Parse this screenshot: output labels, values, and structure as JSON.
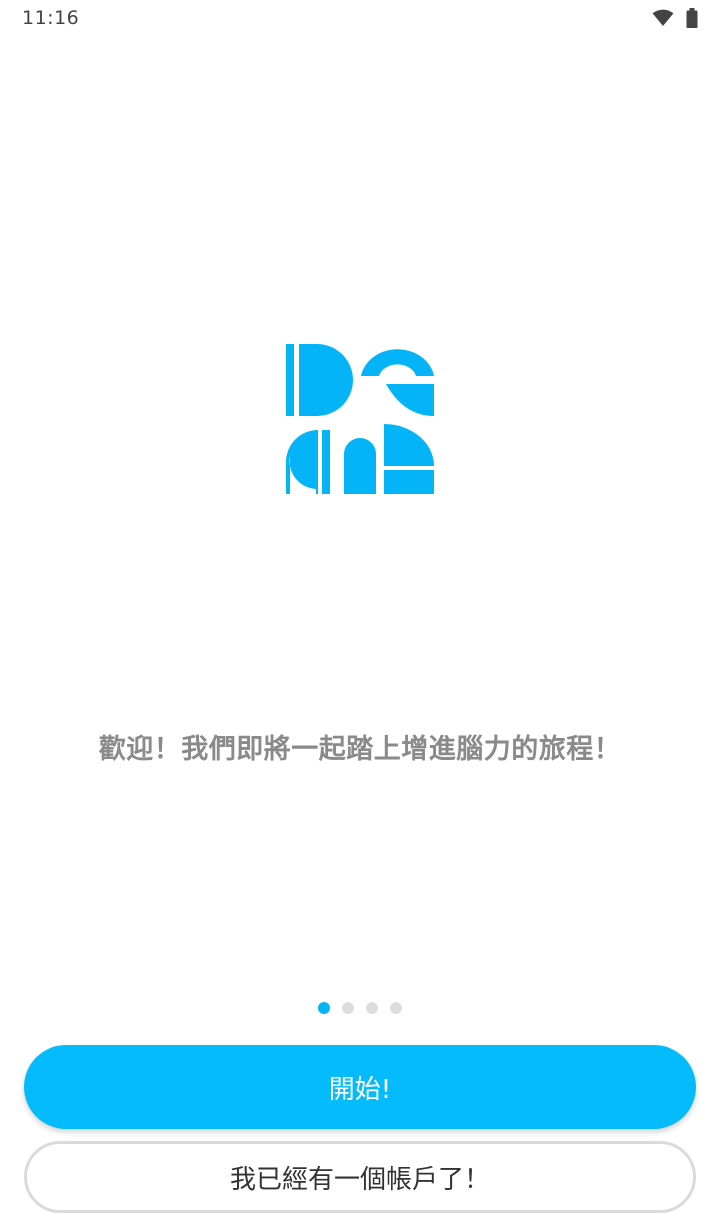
{
  "status_bar": {
    "time": "11:16",
    "icons": [
      "wifi-icon",
      "battery-icon"
    ]
  },
  "logo": {
    "icon": "brand-logo-icon",
    "color": "#05b4f7"
  },
  "onboarding": {
    "welcome_text": "歡迎！我們即將一起踏上增進腦力的旅程！",
    "page_count": 4,
    "active_page": 1
  },
  "buttons": {
    "start_label": "開始!",
    "existing_account_label": "我已經有一個帳戶了！"
  },
  "colors": {
    "accent": "#05bbfb",
    "text_muted": "#8a8a8a",
    "dot_inactive": "#dcdcdc"
  }
}
